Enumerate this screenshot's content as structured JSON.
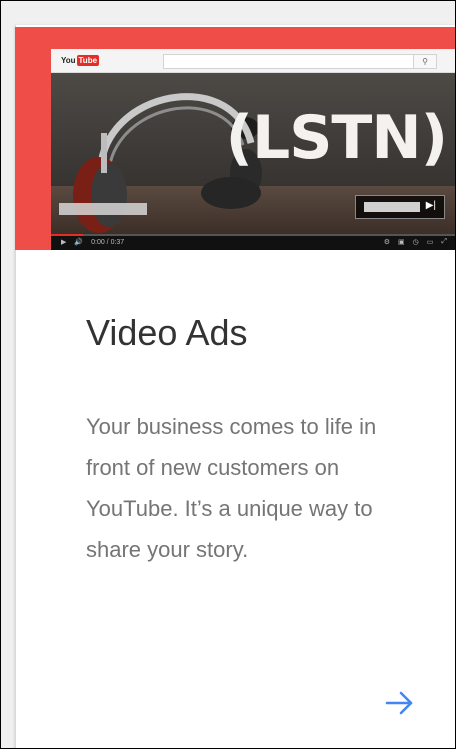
{
  "card": {
    "title": "Video Ads",
    "description": "Your business comes to life in front of new customers on YouTube. It’s a unique way to share your story.",
    "accent_color": "#ef4d48",
    "link_color": "#4285f4",
    "arrow_icon": "arrow-right-icon"
  },
  "hero": {
    "youtube_logo_you": "You",
    "youtube_logo_tube": "Tube",
    "brand_text": "(LSTN)",
    "player_time": "0:00 / 0:37",
    "video_progress": 0.08
  }
}
